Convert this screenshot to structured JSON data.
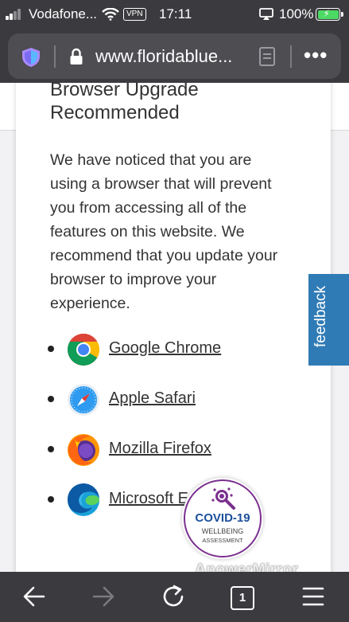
{
  "status_bar": {
    "carrier": "Vodafone...",
    "vpn_label": "VPN",
    "time": "17:11",
    "battery_percent": "100%",
    "signal_bars": 4,
    "signal_bars_filled": 2
  },
  "browser": {
    "url": "www.floridablue...",
    "tab_count": "1"
  },
  "modal": {
    "title": "Browser Upgrade Recommended",
    "body": "We have noticed that you are using a browser that will prevent you from accessing all of the features on this website. We recommend that you update your browser to improve your experience.",
    "browsers": [
      {
        "label": "Google Chrome",
        "icon": "chrome-icon"
      },
      {
        "label": "Apple Safari",
        "icon": "safari-icon"
      },
      {
        "label": "Mozilla Firefox",
        "icon": "firefox-icon"
      },
      {
        "label": "Microsoft Edge",
        "icon": "edge-icon"
      }
    ]
  },
  "feedback_tab": {
    "label": "feedback"
  },
  "covid_badge": {
    "title": "COVID-19",
    "line1": "WELLBEING",
    "line2": "ASSESSMENT"
  },
  "watermark": "ApowerMirror",
  "colors": {
    "toolbar_bg": "#3b3b3f",
    "feedback_blue": "#2f7bb6",
    "covid_purple": "#7b2f8f",
    "covid_blue": "#1b4f9c",
    "battery_green": "#4cd964"
  }
}
